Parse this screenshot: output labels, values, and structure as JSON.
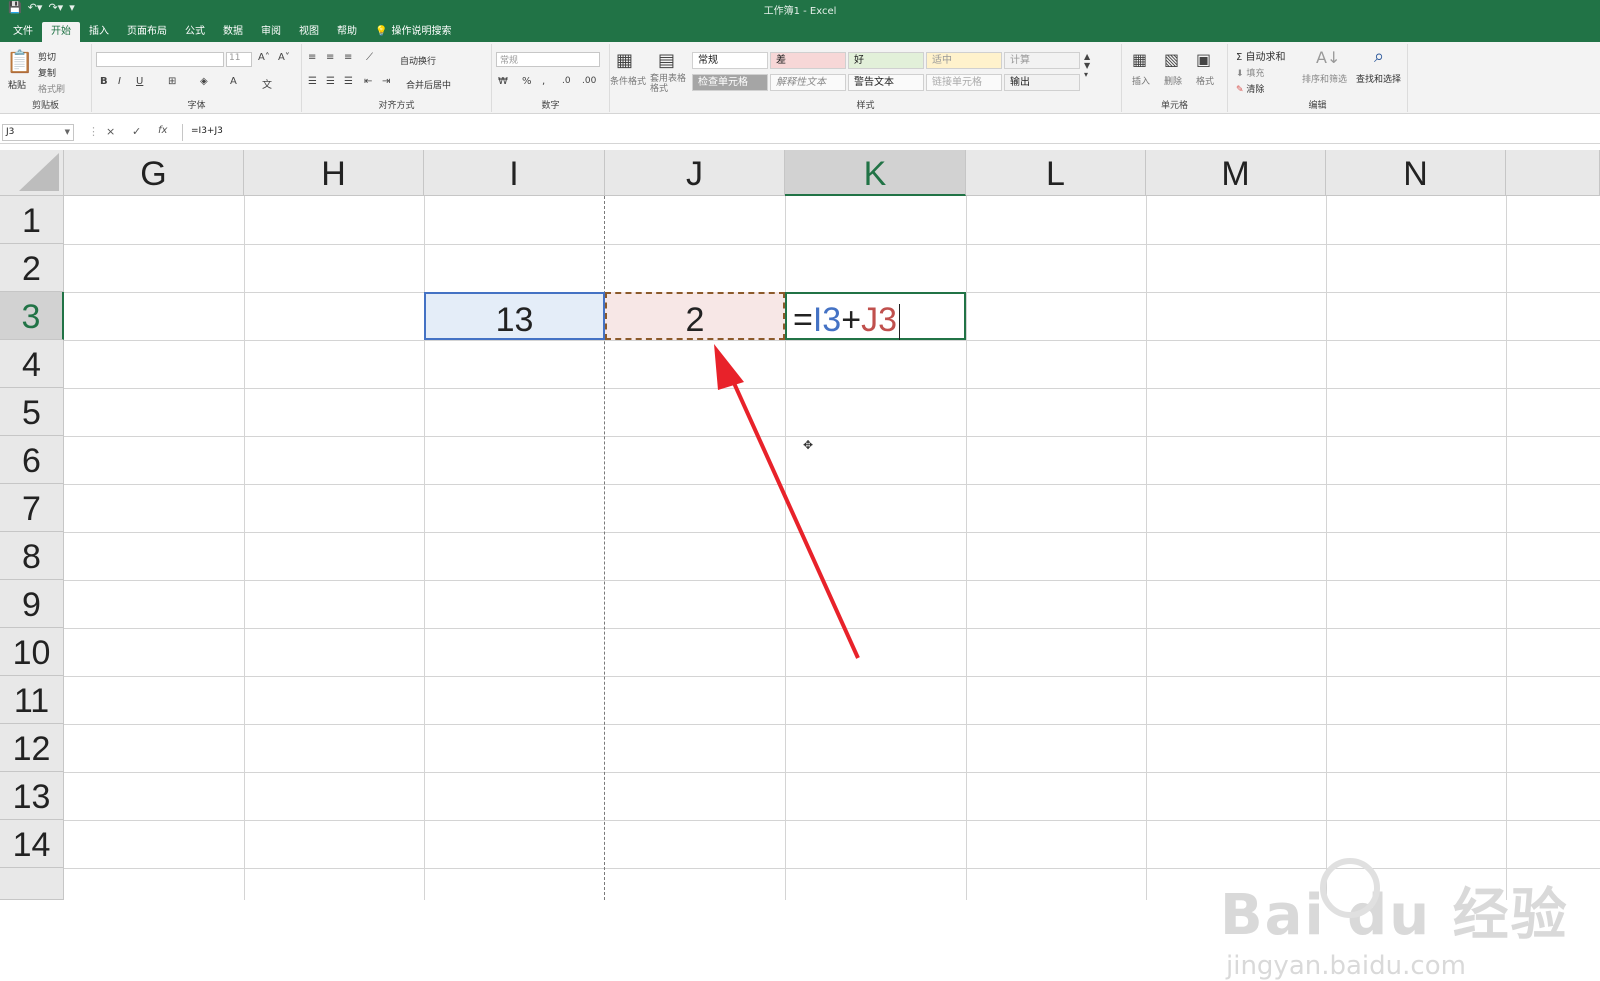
{
  "titlebar": {
    "title": "工作簿1 - Excel"
  },
  "tabs": [
    "文件",
    "开始",
    "插入",
    "页面布局",
    "公式",
    "数据",
    "审阅",
    "视图",
    "帮助"
  ],
  "active_tab": "开始",
  "tell_me": "操作说明搜索",
  "ribbon": {
    "clipboard": {
      "paste": "粘贴",
      "cut": "剪切",
      "copy": "复制",
      "format_painter": "格式刷",
      "label": "剪贴板"
    },
    "font": {
      "size": "11",
      "label": "字体",
      "bold": "B",
      "italic": "I",
      "underline": "U"
    },
    "alignment": {
      "wrap": "自动换行",
      "merge": "合并后居中",
      "label": "对齐方式"
    },
    "number": {
      "format": "常规",
      "percent": "%",
      "label": "数字"
    },
    "styles": {
      "conditional": "条件格式",
      "table": "套用表格格式",
      "cells": [
        "常规",
        "差",
        "好",
        "适中",
        "计算",
        "检查单元格",
        "解释性文本",
        "警告文本",
        "链接单元格",
        "输出"
      ],
      "label": "样式"
    },
    "cells": {
      "insert": "插入",
      "delete": "删除",
      "format": "格式",
      "label": "单元格"
    },
    "editing": {
      "autosum": "自动求和",
      "fill": "填充",
      "clear": "清除",
      "sort": "排序和筛选",
      "find": "查找和选择",
      "label": "编辑"
    }
  },
  "formula_bar": {
    "name_box": "J3",
    "formula": "=I3+J3",
    "cancel": "×",
    "enter": "✓",
    "fx": "fx"
  },
  "columns": [
    "G",
    "H",
    "I",
    "J",
    "K",
    "L",
    "M",
    "N"
  ],
  "selected_column": "K",
  "rows": [
    "1",
    "2",
    "3",
    "4",
    "5",
    "6",
    "7",
    "8",
    "9",
    "10",
    "11",
    "12",
    "13",
    "14"
  ],
  "selected_row": "3",
  "cells": {
    "I3": "13",
    "J3": "2",
    "K3": {
      "eq": "=",
      "ref1": "I3",
      "plus": "+",
      "ref2": "J3"
    }
  },
  "watermark": {
    "main": "Bai du 经验",
    "sub": "jingyan.baidu.com"
  }
}
